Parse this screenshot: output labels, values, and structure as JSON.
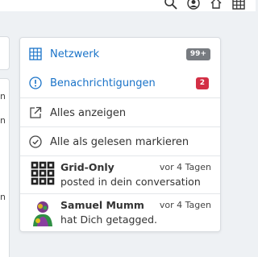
{
  "topbar": {
    "icons": [
      "search-icon",
      "user-icon",
      "home-icon",
      "grid-icon"
    ]
  },
  "left_panel": {
    "fragments": [
      "n",
      "n",
      "n"
    ]
  },
  "dropdown": {
    "items": [
      {
        "label": "Netzwerk",
        "icon": "network-grid-icon",
        "badge": "99+",
        "badge_color": "#777b80",
        "style": "link"
      },
      {
        "label": "Benachrichtigungen",
        "icon": "alert-circle-icon",
        "badge": "2",
        "badge_color": "#d32f45",
        "style": "link"
      },
      {
        "label": "Alles anzeigen",
        "icon": "external-link-icon",
        "style": "plain"
      },
      {
        "label": "Alle als gelesen markieren",
        "icon": "check-circle-icon",
        "style": "plain"
      }
    ],
    "notifications": [
      {
        "title": "Grid-Only",
        "time": "vor 4 Tagen",
        "text": "posted in dein conversation",
        "avatar": "grid-only-avatar"
      },
      {
        "title": "Samuel Mumm",
        "time": "vor 4 Tagen",
        "text": "hat Dich getagged.",
        "avatar": "samuel-mumm-avatar"
      }
    ]
  },
  "colors": {
    "link": "#1a73c8",
    "badge_grey": "#777b80",
    "badge_red": "#d32f45"
  }
}
